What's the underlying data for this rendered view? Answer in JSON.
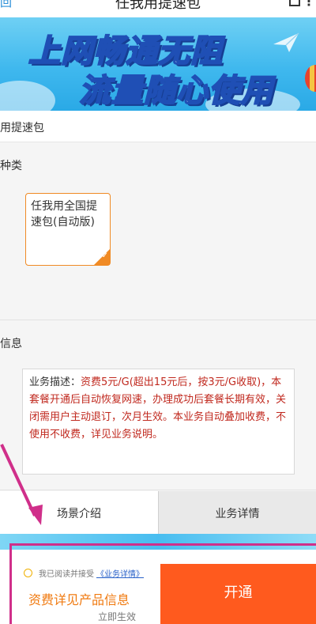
{
  "topbar": {
    "back_icon_text": "回",
    "title": "任我用提速包",
    "more_icon_text": "⋮"
  },
  "banner": {
    "line1": "上网畅通无阻",
    "line2": "流量随心使用"
  },
  "package_header": "用提速包",
  "type_section": {
    "label": "种类",
    "option_label": "任我用全国提速包(自动版)"
  },
  "info_section": {
    "label": "信息",
    "desc_label": "业务描述：",
    "desc_text": "资费5元/G(超出15元后，按3元/G收取)，本套餐开通后自动恢复网速，办理成功后套餐长期有效，关闭需用户主动退订，次月生效。本业务自动叠加收费，不使用不收费，详见业务说明。"
  },
  "tabs": {
    "scene": "场景介绍",
    "detail": "业务详情"
  },
  "bottom": {
    "agree_text": "我已阅读并接受",
    "agree_link": "《业务详情》",
    "price_info": "资费详见产品信息",
    "effective": "立即生效",
    "open_label": "开通"
  },
  "colors": {
    "accent_orange": "#ff5a1e",
    "option_border": "#f08a24",
    "desc_red": "#c0281e",
    "annotation_pink": "#d02f8a"
  }
}
